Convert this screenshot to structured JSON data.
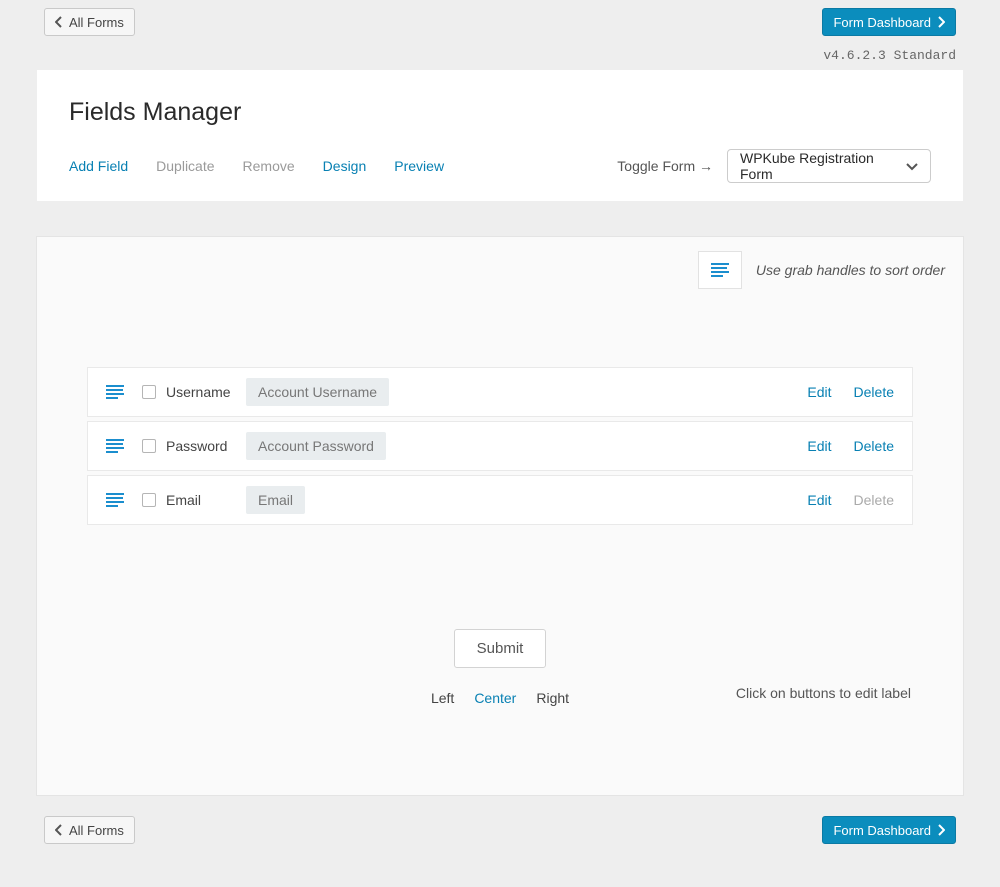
{
  "nav": {
    "back_label": "All Forms",
    "dashboard_label": "Form Dashboard"
  },
  "version": "v4.6.2.3 Standard",
  "header": {
    "title": "Fields Manager",
    "actions": {
      "add_field": "Add Field",
      "duplicate": "Duplicate",
      "remove": "Remove",
      "design": "Design",
      "preview": "Preview"
    },
    "toggle_label": "Toggle Form →",
    "selected_form": "WPKube Registration Form"
  },
  "workspace": {
    "hint": "Use grab handles to sort order",
    "edit_hint": "Click on buttons to edit label",
    "submit_label": "Submit",
    "alignment": {
      "left": "Left",
      "center": "Center",
      "right": "Right",
      "active": "center"
    }
  },
  "fields": [
    {
      "name": "Username",
      "placeholder": "Account Username",
      "edit": "Edit",
      "delete": "Delete",
      "delete_enabled": true
    },
    {
      "name": "Password",
      "placeholder": "Account Password",
      "edit": "Edit",
      "delete": "Delete",
      "delete_enabled": true
    },
    {
      "name": "Email",
      "placeholder": "Email",
      "edit": "Edit",
      "delete": "Delete",
      "delete_enabled": false
    }
  ]
}
